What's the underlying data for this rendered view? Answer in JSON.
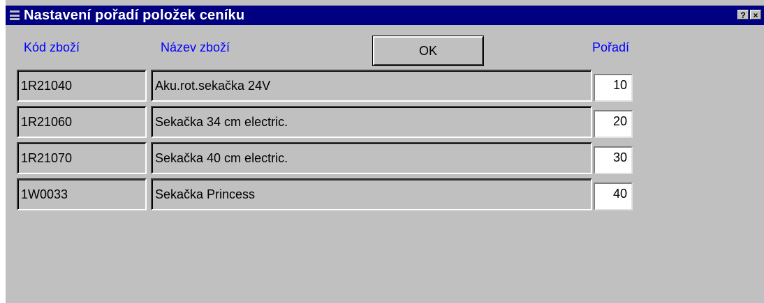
{
  "window": {
    "title": "Nastavení pořadí položek ceníku",
    "help_label": "?",
    "close_label": "×"
  },
  "columns": {
    "code": "Kód zboží",
    "name": "Název zboží",
    "order": "Pořadí"
  },
  "ok_label": "OK",
  "rows": [
    {
      "code": "1R21040",
      "name": "Aku.rot.sekačka 24V",
      "order": "10"
    },
    {
      "code": "1R21060",
      "name": "Sekačka 34 cm electric.",
      "order": "20"
    },
    {
      "code": "1R21070",
      "name": "Sekačka 40 cm electric.",
      "order": "30"
    },
    {
      "code": "1W0033",
      "name": "Sekačka Princess",
      "order": "40"
    }
  ],
  "colors": {
    "titlebar": "#000080",
    "label": "#0000ff",
    "background": "#c0c0c0"
  }
}
